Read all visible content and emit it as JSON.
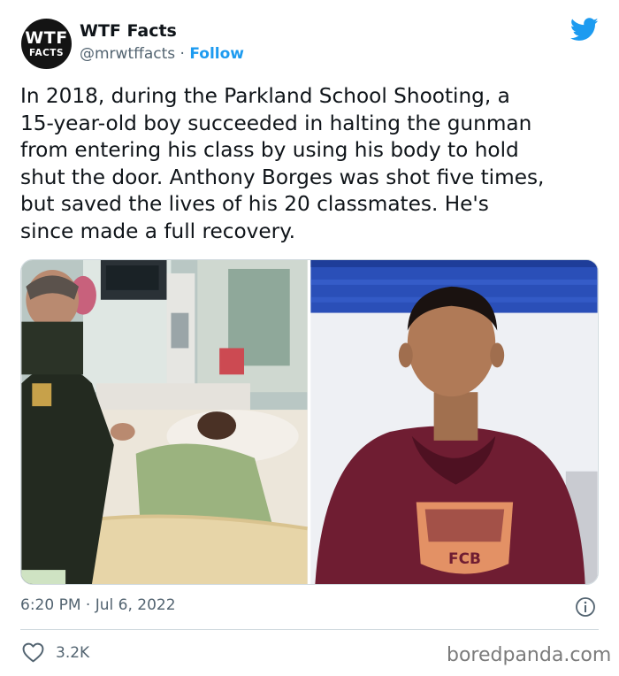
{
  "author": {
    "avatar_line1": "WTF",
    "avatar_line2": "FACTS",
    "name": "WTF Facts",
    "handle": "@mrwtffacts",
    "separator": "·",
    "follow_label": "Follow"
  },
  "tweet": {
    "lines": [
      "In 2018, during the Parkland School Shooting, a",
      "15-year-old boy succeeded in halting the gunman",
      "from entering his class by using his body to hold",
      "shut the door. Anthony Borges was shot five times,",
      "but saved the lives of his 20 classmates. He's",
      "since made a full recovery."
    ],
    "timestamp": "6:20 PM · Jul 6, 2022",
    "likes": "3.2K"
  },
  "media": {
    "hoodie_text": "FCB"
  },
  "icons": {
    "brand": "twitter-bird-icon",
    "info": "info-icon",
    "like": "heart-icon"
  },
  "colors": {
    "link": "#1d9bf0",
    "muted": "#536471",
    "text": "#0f1419"
  },
  "source": "boredpanda.com"
}
